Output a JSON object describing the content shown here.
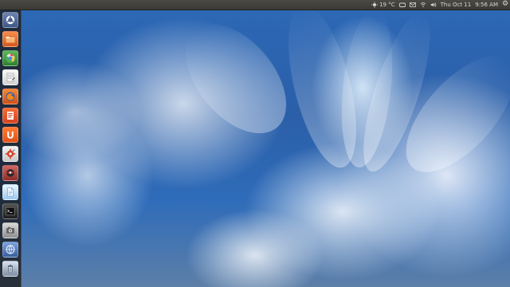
{
  "top_panel": {
    "weather": "19 °C",
    "date": "Thu Oct 11",
    "time": "9:56 AM",
    "icons": [
      "sun-icon",
      "cloud-icon",
      "mail-icon",
      "wifi-icon",
      "volume-icon",
      "gear-icon"
    ]
  },
  "launcher": {
    "items": [
      {
        "name": "dash-home",
        "color": "#546e99"
      },
      {
        "name": "files",
        "color": "#e16c2d"
      },
      {
        "name": "chromium",
        "color": "#4f9d4d"
      },
      {
        "name": "text-editor",
        "color": "#e4e4e4"
      },
      {
        "name": "firefox",
        "color": "#f27b27"
      },
      {
        "name": "office",
        "color": "#e55c2b"
      },
      {
        "name": "ubuntu-software",
        "color": "#ef6b22"
      },
      {
        "name": "system-settings",
        "color": "#d84334"
      },
      {
        "name": "browser-helper",
        "color": "#b83835"
      },
      {
        "name": "document-viewer",
        "color": "#7db9e8"
      },
      {
        "name": "terminal",
        "color": "#2f2f2f"
      },
      {
        "name": "camera",
        "color": "#a9a9a9"
      },
      {
        "name": "network-tools",
        "color": "#587cb8"
      },
      {
        "name": "trash",
        "color": "#a7b3c4"
      }
    ]
  }
}
